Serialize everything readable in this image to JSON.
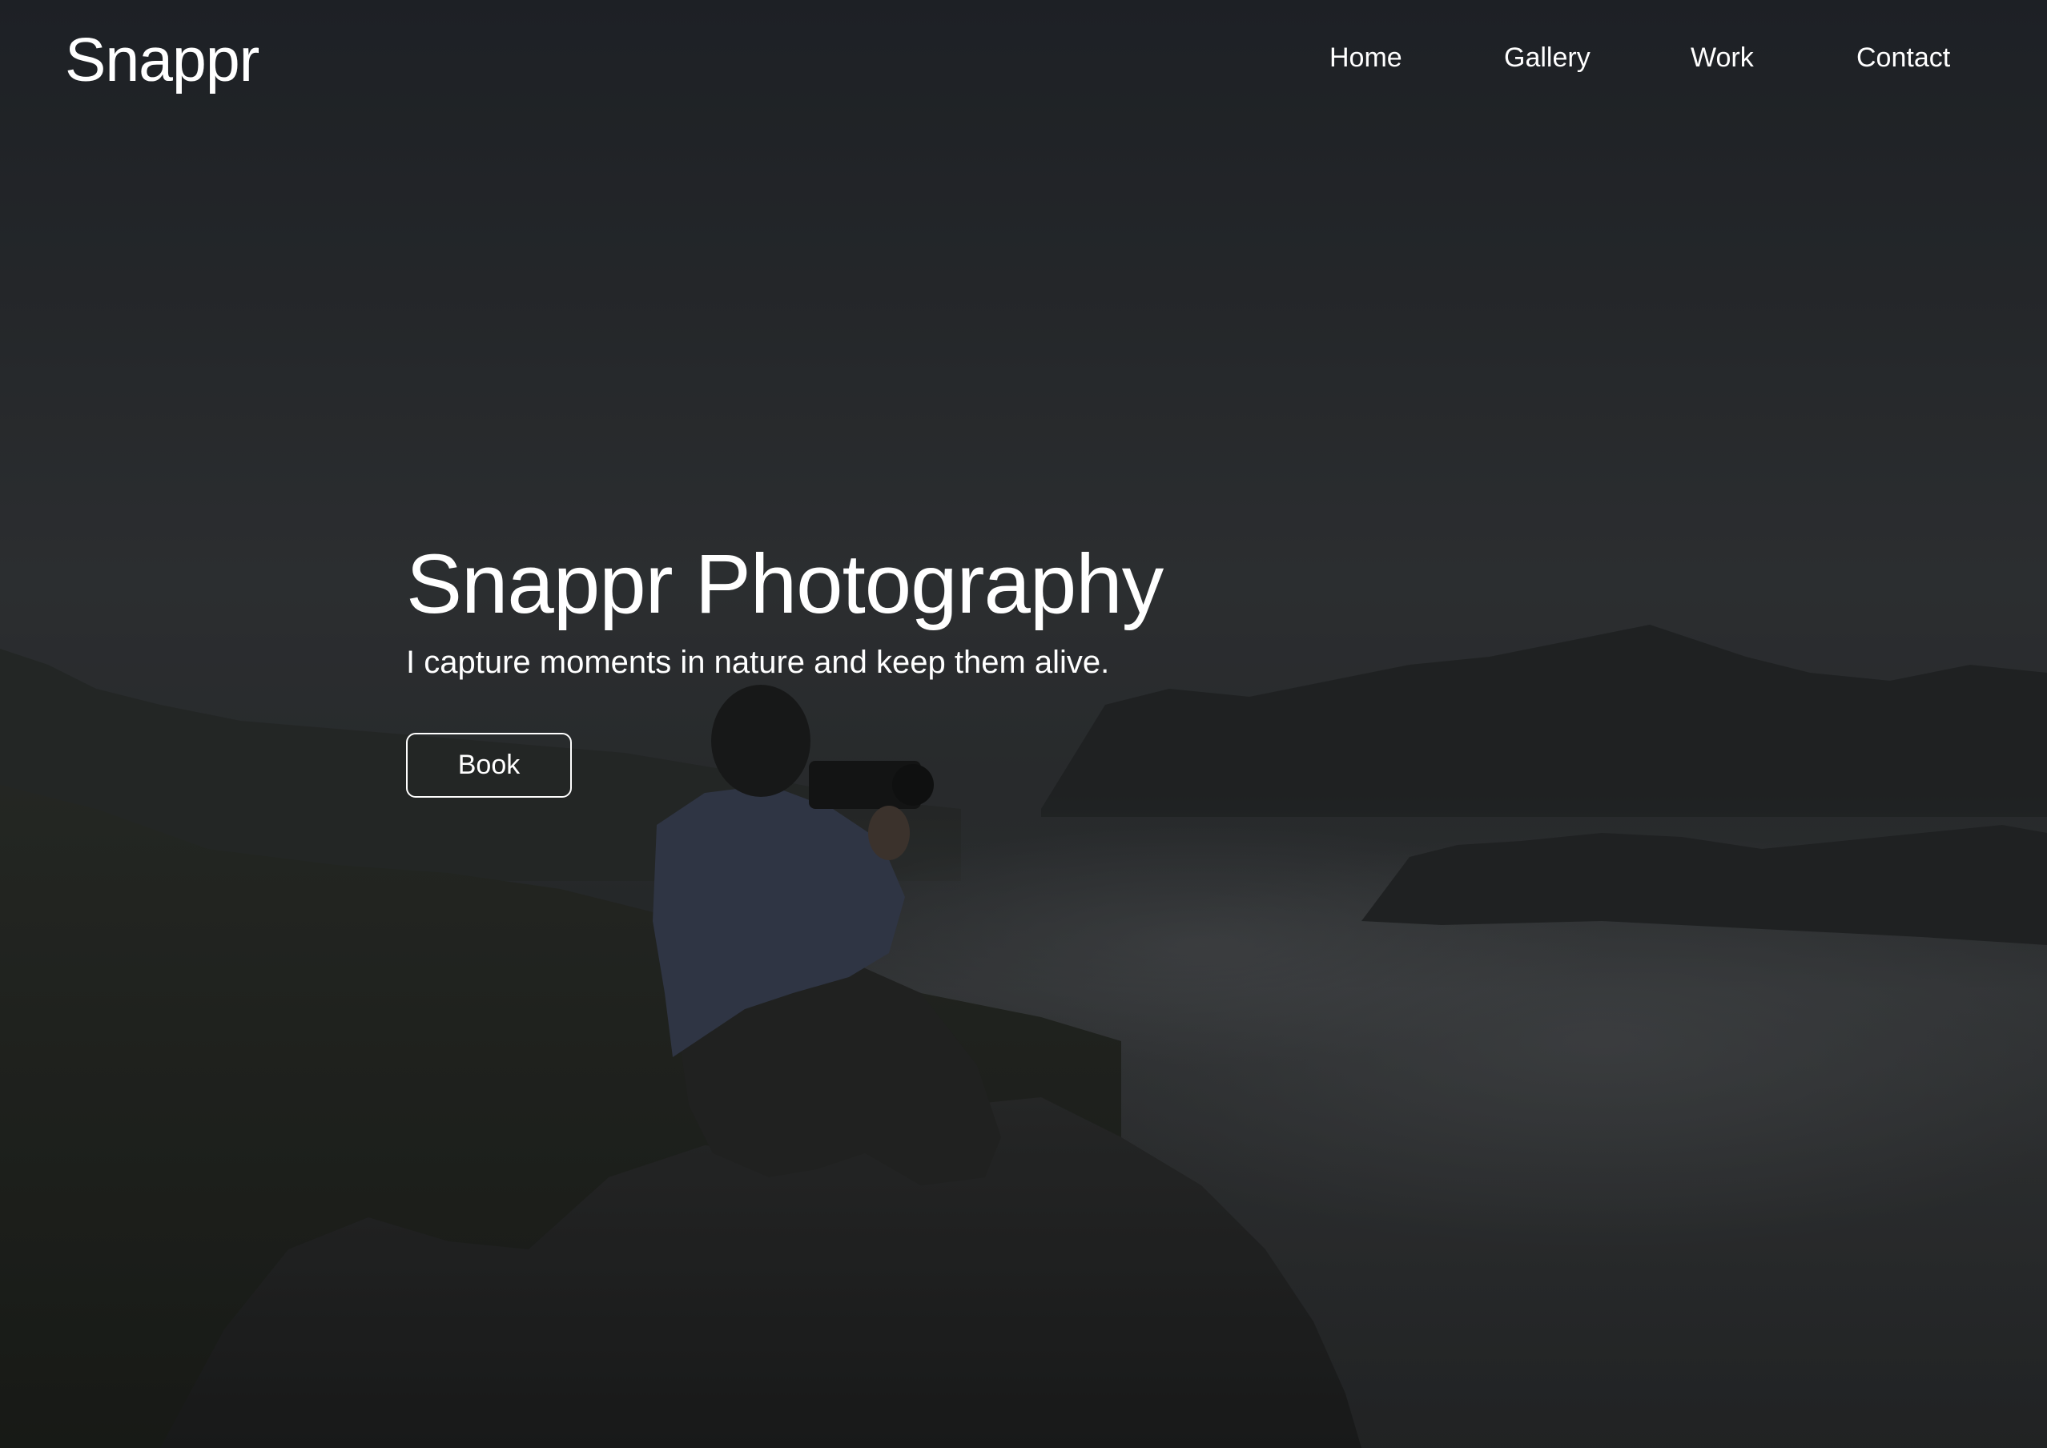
{
  "brand": {
    "logo_text": "Snappr"
  },
  "nav": {
    "items": [
      {
        "label": "Home"
      },
      {
        "label": "Gallery"
      },
      {
        "label": "Work"
      },
      {
        "label": "Contact"
      }
    ]
  },
  "hero": {
    "title": "Snappr Photography",
    "subtitle": "I capture moments in nature and keep them alive.",
    "cta_label": "Book",
    "overlay_color": "#1b1c1f",
    "background_image": "photographer-on-rock-above-fog-valley"
  }
}
